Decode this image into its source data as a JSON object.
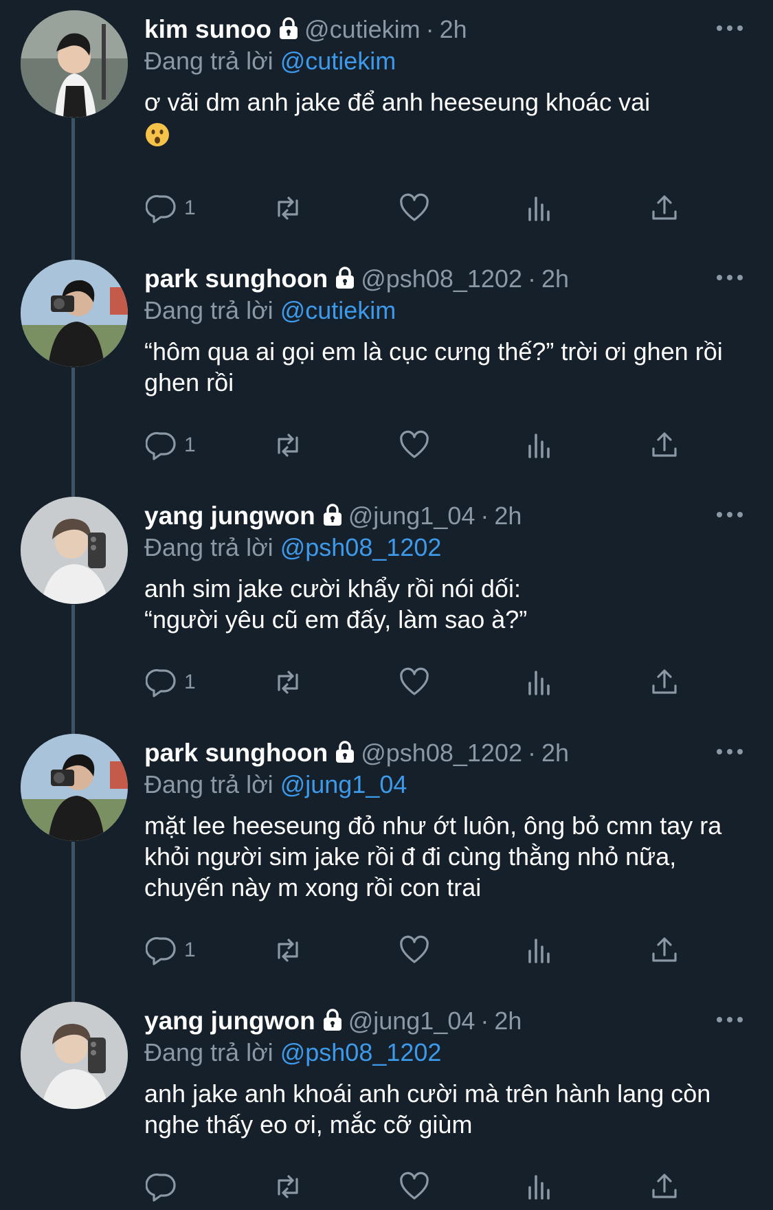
{
  "tweets": [
    {
      "name": "kim sunoo",
      "handle": "@cutiekim",
      "dot": "·",
      "time": "2h",
      "reply_prefix": "Đang trả lời",
      "reply_to": "@cutiekim",
      "text": "ơ vãi dm anh jake để anh heeseung khoác vai",
      "emoji": "hushed-face-emoji",
      "reply_count": "1"
    },
    {
      "name": "park sunghoon",
      "handle": "@psh08_1202",
      "dot": "·",
      "time": "2h",
      "reply_prefix": "Đang trả lời",
      "reply_to": "@cutiekim",
      "text": "“hôm qua ai gọi em là cục cưng thế?” trời ơi ghen rồi ghen rồi",
      "reply_count": "1"
    },
    {
      "name": "yang jungwon",
      "handle": "@jung1_04",
      "dot": "·",
      "time": "2h",
      "reply_prefix": "Đang trả lời",
      "reply_to": "@psh08_1202",
      "text": "anh sim jake cười khẩy rồi nói dối: “người yêu cũ em đấy, làm sao à?”",
      "reply_count": "1"
    },
    {
      "name": "park sunghoon",
      "handle": "@psh08_1202",
      "dot": "·",
      "time": "2h",
      "reply_prefix": "Đang trả lời",
      "reply_to": "@jung1_04",
      "text": "mặt lee heeseung đỏ như ớt luôn, ông bỏ cmn tay ra khỏi người sim jake rồi đ đi cùng thằng nhỏ nữa, chuyến này m xong rồi con trai",
      "reply_count": "1"
    },
    {
      "name": "yang jungwon",
      "handle": "@jung1_04",
      "dot": "·",
      "time": "2h",
      "reply_prefix": "Đang trả lời",
      "reply_to": "@psh08_1202",
      "text": "anh jake anh khoái anh cười mà trên hành lang còn nghe thấy eo ơi, mắc cỡ giùm",
      "reply_count": ""
    }
  ],
  "icons": {
    "lock": "lock-icon",
    "more": "more-icon",
    "reply": "reply-icon",
    "retweet": "retweet-icon",
    "like": "heart-icon",
    "views": "views-icon",
    "share": "share-icon"
  },
  "colors": {
    "background": "#15202b",
    "secondary_text": "#8b98a5",
    "mention": "#3d9aeb",
    "thread_line": "#3d5466"
  }
}
